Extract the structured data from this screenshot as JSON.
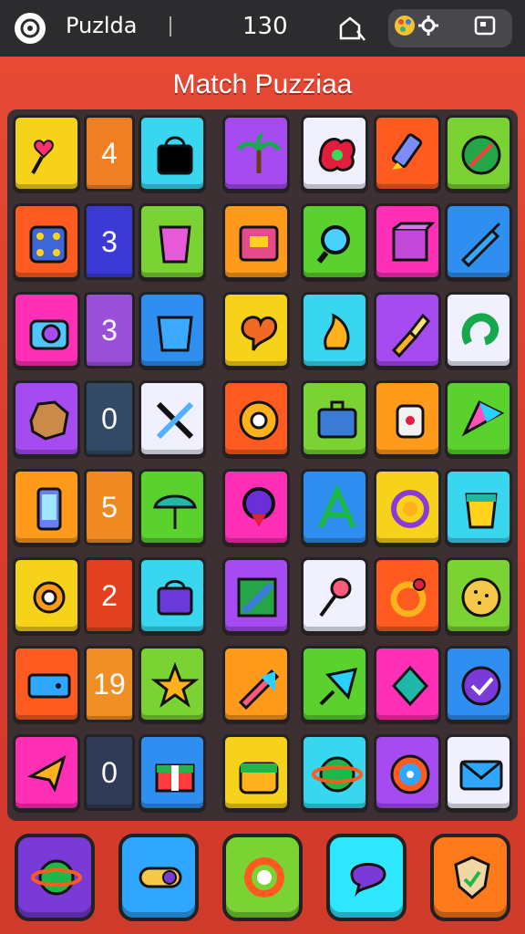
{
  "topbar": {
    "app_name": "Puzlda",
    "score": "130"
  },
  "title": "Match Puzziaa",
  "row_numbers": [
    "4",
    "3",
    "3",
    "0",
    "5",
    "2",
    "19",
    "0"
  ],
  "colors": {
    "background": "#d9402f",
    "topbar": "#2c2c2e",
    "board": "#2f2f33"
  },
  "tiles": [
    [
      "heart-pin-icon",
      "bag-icon",
      "palm-tree-icon",
      "splat-icon",
      "marker-icon",
      "compass-icon"
    ],
    [
      "dice-icon",
      "cup-icon",
      "box-icon",
      "magnifier-icon",
      "cube-icon",
      "pen-icon"
    ],
    [
      "camera-icon",
      "bucket-icon",
      "heart-bubble-icon",
      "flame-icon",
      "brush-icon",
      "hook-icon"
    ],
    [
      "rock-icon",
      "crossed-tools-icon",
      "disc-icon",
      "briefcase-icon",
      "bottle-icon",
      "kite-icon"
    ],
    [
      "phone-icon",
      "umbrella-icon",
      "map-pin-icon",
      "letter-a-icon",
      "at-ring-icon",
      "drink-cup-icon"
    ],
    [
      "gear-icon",
      "lock-box-icon",
      "pencil-icon",
      "pin-icon",
      "ring-icon",
      "cookie-icon"
    ],
    [
      "ticket-icon",
      "star-icon",
      "ruler-icon",
      "dart-icon",
      "diamond-icon",
      "check-icon"
    ],
    [
      "arrow-star-icon",
      "gift-icon",
      "cake-icon",
      "planet-icon",
      "target-icon",
      "envelope-icon"
    ]
  ],
  "dock": [
    "planet-icon",
    "toggle-icon",
    "lifebuoy-icon",
    "chat-icon",
    "shield-icon"
  ]
}
